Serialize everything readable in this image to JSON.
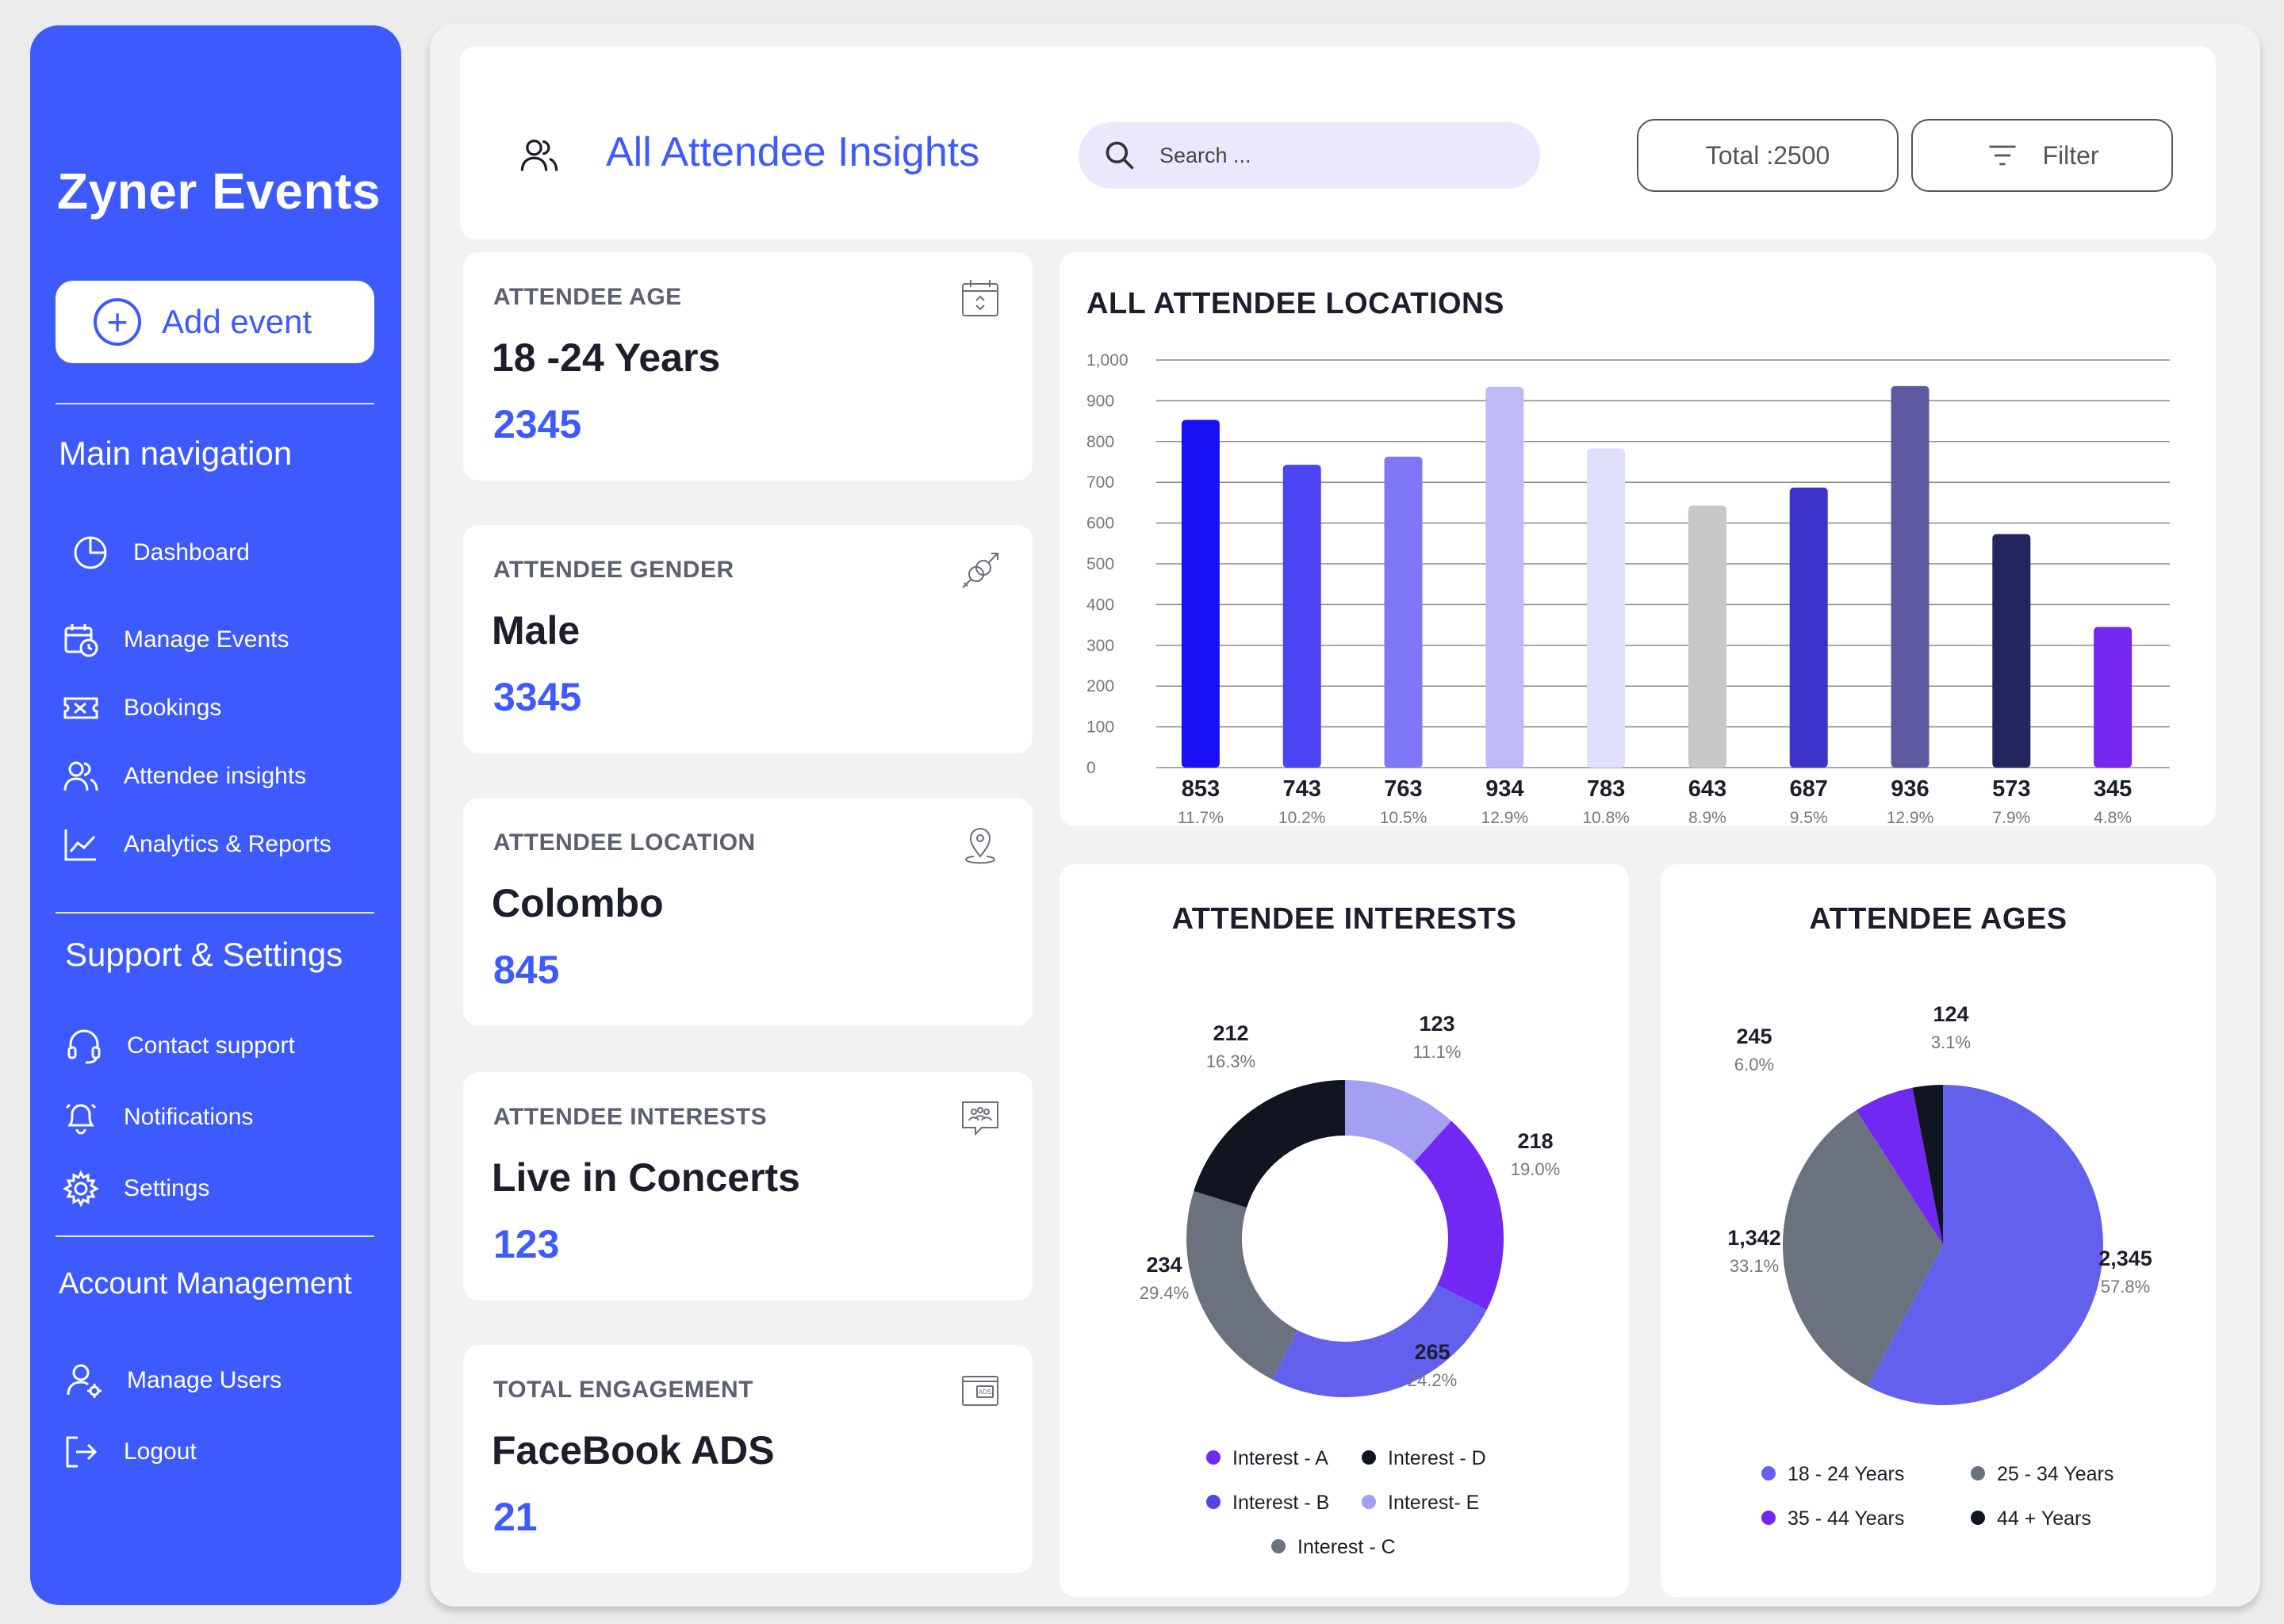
{
  "sidebar": {
    "brand": "Zyner Events",
    "add_event": "Add event",
    "main_nav_title": "Main navigation",
    "main_nav": [
      {
        "label": "Dashboard",
        "icon": "pie-chart-icon"
      },
      {
        "label": "Manage Events",
        "icon": "calendar-clock-icon"
      },
      {
        "label": "Bookings",
        "icon": "ticket-icon"
      },
      {
        "label": "Attendee insights",
        "icon": "users-icon"
      },
      {
        "label": "Analytics & Reports",
        "icon": "line-chart-icon"
      }
    ],
    "support_title": "Support & Settings",
    "support_nav": [
      {
        "label": "Contact support",
        "icon": "headset-icon"
      },
      {
        "label": "Notifications",
        "icon": "bell-icon"
      },
      {
        "label": "Settings",
        "icon": "gear-icon"
      }
    ],
    "account_title": "Account Management",
    "account_nav": [
      {
        "label": "Manage Users",
        "icon": "user-gear-icon"
      },
      {
        "label": "Logout",
        "icon": "logout-icon"
      }
    ]
  },
  "header": {
    "title": "All Attendee Insights",
    "search_placeholder": "Search ...",
    "total_label": "Total :2500",
    "filter_label": "Filter"
  },
  "stats": [
    {
      "label": "ATTENDEE AGE",
      "value": "18 -24 Years",
      "number": "2345",
      "icon": "calendar-icon"
    },
    {
      "label": "ATTENDEE GENDER",
      "value": "Male",
      "number": "3345",
      "icon": "gender-icon"
    },
    {
      "label": "ATTENDEE LOCATION",
      "value": "Colombo",
      "number": "845",
      "icon": "location-pin-icon"
    },
    {
      "label": "ATTENDEE INTERESTS",
      "value": "Live in Concerts",
      "number": "123",
      "icon": "people-board-icon"
    },
    {
      "label": "TOTAL ENGAGEMENT",
      "value": "FaceBook ADS",
      "number": "21",
      "icon": "ads-icon"
    }
  ],
  "colors": {
    "accent": "#3d5afe"
  },
  "chart_data": [
    {
      "type": "bar",
      "title": "ALL ATTENDEE LOCATIONS",
      "ylim": [
        0,
        1000
      ],
      "yticks": [
        "0",
        "100",
        "200",
        "300",
        "400",
        "500",
        "600",
        "700",
        "800",
        "900",
        "1,000"
      ],
      "grid": true,
      "values": [
        853,
        743,
        763,
        934,
        783,
        643,
        687,
        936,
        573,
        345
      ],
      "value_labels": [
        "853",
        "743",
        "763",
        "934",
        "783",
        "643",
        "687",
        "936",
        "573",
        "345"
      ],
      "percent_labels": [
        "11.7%",
        "10.2%",
        "10.5%",
        "12.9%",
        "10.8%",
        "8.9%",
        "9.5%",
        "12.9%",
        "7.9%",
        "4.8%"
      ],
      "colors": [
        "#1a10f5",
        "#4b44f4",
        "#7e78f6",
        "#bdbaf7",
        "#e1e0fb",
        "#c8c8c8",
        "#3b33c9",
        "#5d5aa1",
        "#25245e",
        "#7627f0"
      ]
    },
    {
      "type": "pie",
      "title": "ATTENDEE INTERESTS",
      "slices": [
        {
          "value": 123,
          "label": "123",
          "percent": "11.1%",
          "color": "#a49ff2"
        },
        {
          "value": 218,
          "label": "218",
          "percent": "19.0%",
          "color": "#7128f2"
        },
        {
          "value": 265,
          "label": "265",
          "percent": "24.2%",
          "color": "#6360ee"
        },
        {
          "value": 234,
          "label": "234",
          "percent": "29.4%",
          "color": "#6c7180"
        },
        {
          "value": 212,
          "label": "212",
          "percent": "16.3%",
          "color": "#111522"
        }
      ],
      "legend": [
        {
          "label": "Interest - A",
          "color": "#7128f2"
        },
        {
          "label": "Interest - D",
          "color": "#111522"
        },
        {
          "label": "Interest - B",
          "color": "#5145e8"
        },
        {
          "label": "Interest- E",
          "color": "#a49ff2"
        },
        {
          "label": "Interest - C",
          "color": "#6c7180"
        }
      ]
    },
    {
      "type": "pie",
      "title": "ATTENDEE AGES",
      "slices": [
        {
          "value": 2345,
          "label": "2,345",
          "percent": "57.8%",
          "color": "#6360ee"
        },
        {
          "value": 1342,
          "label": "1,342",
          "percent": "33.1%",
          "color": "#6c7180"
        },
        {
          "value": 245,
          "label": "245",
          "percent": "6.0%",
          "color": "#7128f2"
        },
        {
          "value": 124,
          "label": "124",
          "percent": "3.1%",
          "color": "#111522"
        }
      ],
      "legend": [
        {
          "label": "18 - 24 Years",
          "color": "#6360ee"
        },
        {
          "label": "25 - 34 Years",
          "color": "#6c7180"
        },
        {
          "label": "35 - 44 Years",
          "color": "#7128f2"
        },
        {
          "label": "44 + Years",
          "color": "#111522"
        }
      ]
    }
  ]
}
